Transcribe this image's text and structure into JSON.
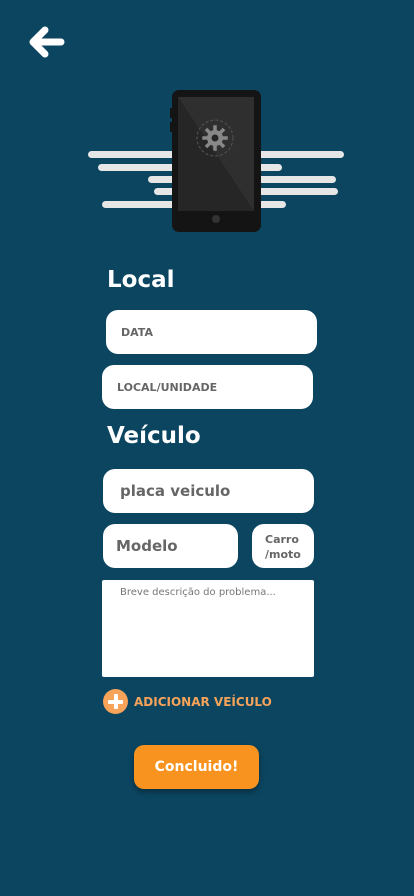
{
  "colors": {
    "background": "#0b4560",
    "accent": "#f7931e",
    "accent_light": "#f7a35a",
    "field": "#ffffff"
  },
  "header": {
    "back_icon": "arrow-left-icon"
  },
  "illustration": {
    "name": "phone-settings-illustration"
  },
  "local": {
    "title": "Local",
    "date_placeholder": "DATA",
    "place_placeholder": "LOCAL/UNIDADE"
  },
  "vehicle": {
    "title": "Veículo",
    "plate_placeholder": "placa veiculo",
    "model_placeholder": "Modelo",
    "type_line1": "Carro",
    "type_line2": "/moto",
    "description_placeholder": "Breve descrição do problema..."
  },
  "add_vehicle": {
    "icon": "plus-circle-icon",
    "label": "ADICIONAR VEÍCULO"
  },
  "submit": {
    "label": "Concluido!"
  }
}
